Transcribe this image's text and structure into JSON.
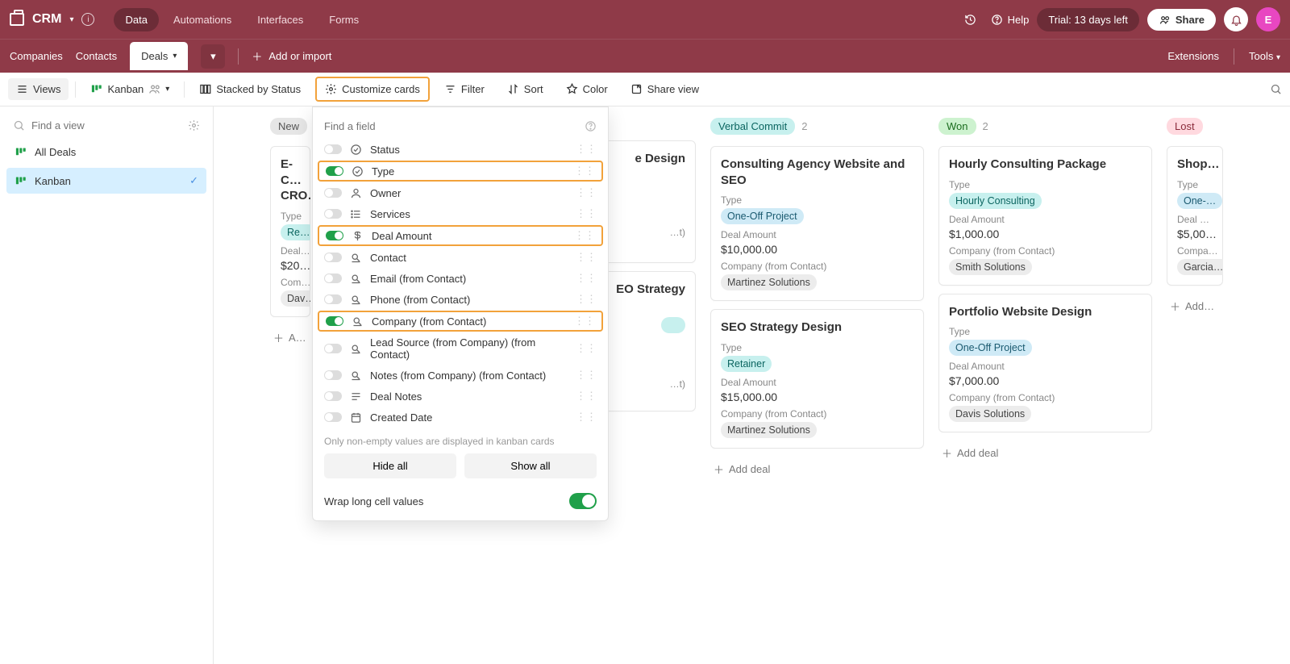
{
  "app": {
    "name": "CRM"
  },
  "nav": {
    "tabs": [
      "Data",
      "Automations",
      "Interfaces",
      "Forms"
    ],
    "help": "Help",
    "trial": "Trial: 13 days left",
    "share": "Share",
    "avatar": "E"
  },
  "tables": {
    "items": [
      "Companies",
      "Contacts",
      "Deals"
    ],
    "addImport": "Add or import",
    "extensions": "Extensions",
    "tools": "Tools"
  },
  "toolbar": {
    "views": "Views",
    "kanban": "Kanban",
    "stacked": "Stacked by Status",
    "customize": "Customize cards",
    "filter": "Filter",
    "sort": "Sort",
    "color": "Color",
    "shareView": "Share view"
  },
  "sidebar": {
    "findPlaceholder": "Find a view",
    "items": [
      {
        "label": "All Deals",
        "active": false
      },
      {
        "label": "Kanban",
        "active": true
      }
    ]
  },
  "popover": {
    "findField": "Find a field",
    "fields": [
      {
        "label": "Status",
        "on": false,
        "hl": false,
        "icon": "check-circle"
      },
      {
        "label": "Type",
        "on": true,
        "hl": true,
        "icon": "check-circle"
      },
      {
        "label": "Owner",
        "on": false,
        "hl": false,
        "icon": "user"
      },
      {
        "label": "Services",
        "on": false,
        "hl": false,
        "icon": "list"
      },
      {
        "label": "Deal Amount",
        "on": true,
        "hl": true,
        "icon": "dollar"
      },
      {
        "label": "Contact",
        "on": false,
        "hl": false,
        "icon": "lookup"
      },
      {
        "label": "Email (from Contact)",
        "on": false,
        "hl": false,
        "icon": "lookup"
      },
      {
        "label": "Phone (from Contact)",
        "on": false,
        "hl": false,
        "icon": "lookup"
      },
      {
        "label": "Company (from Contact)",
        "on": true,
        "hl": true,
        "icon": "lookup"
      },
      {
        "label": "Lead Source (from Company) (from Contact)",
        "on": false,
        "hl": false,
        "icon": "lookup"
      },
      {
        "label": "Notes (from Company) (from Contact)",
        "on": false,
        "hl": false,
        "icon": "lookup"
      },
      {
        "label": "Deal Notes",
        "on": false,
        "hl": false,
        "icon": "text"
      },
      {
        "label": "Created Date",
        "on": false,
        "hl": false,
        "icon": "date"
      }
    ],
    "note": "Only non-empty values are displayed in kanban cards",
    "hideAll": "Hide all",
    "showAll": "Show all",
    "wrap": "Wrap long cell values"
  },
  "board": {
    "addDeal": "Add deal",
    "columns": [
      {
        "name": "New",
        "pillClass": "pill-new",
        "count": "",
        "cards": [
          {
            "title": "E-C… CRO…",
            "type": "Re…",
            "amount": "$20…",
            "company": "Dav…"
          }
        ],
        "addLabel": "A…"
      },
      {
        "name": "",
        "pillClass": "",
        "count": "",
        "cards": [
          {
            "title": "e Design",
            "company_label": "…t)"
          },
          {
            "title": "EO Strategy",
            "company_label": "…t)"
          }
        ]
      },
      {
        "name": "Verbal Commit",
        "pillClass": "pill-vc",
        "count": "2",
        "cards": [
          {
            "title": "Consulting Agency Website and SEO",
            "type": "One-Off Project",
            "type_tag": "tag-blue",
            "amount": "$10,000.00",
            "company": "Martinez Solutions"
          },
          {
            "title": "SEO Strategy Design",
            "type": "Retainer",
            "type_tag": "tag-teal",
            "amount": "$15,000.00",
            "company": "Martinez Solutions"
          }
        ]
      },
      {
        "name": "Won",
        "pillClass": "pill-won",
        "count": "2",
        "cards": [
          {
            "title": "Hourly Consulting Package",
            "type": "Hourly Consulting",
            "type_tag": "tag-teal",
            "amount": "$1,000.00",
            "company": "Smith Solutions"
          },
          {
            "title": "Portfolio Website Design",
            "type": "One-Off Project",
            "type_tag": "tag-blue",
            "amount": "$7,000.00",
            "company": "Davis Solutions"
          }
        ]
      },
      {
        "name": "Lost",
        "pillClass": "pill-lost",
        "count": "",
        "cards": [
          {
            "title": "Shop…",
            "type": "One-…",
            "type_tag": "tag-blue",
            "amount": "$5,00…",
            "companyLabel": "Compa…",
            "company": "Garcia…"
          }
        ],
        "addLabel": "Add…"
      }
    ]
  },
  "labels": {
    "type": "Type",
    "dealAmount": "Deal Amount",
    "companyFromContact": "Company (from Contact)"
  }
}
